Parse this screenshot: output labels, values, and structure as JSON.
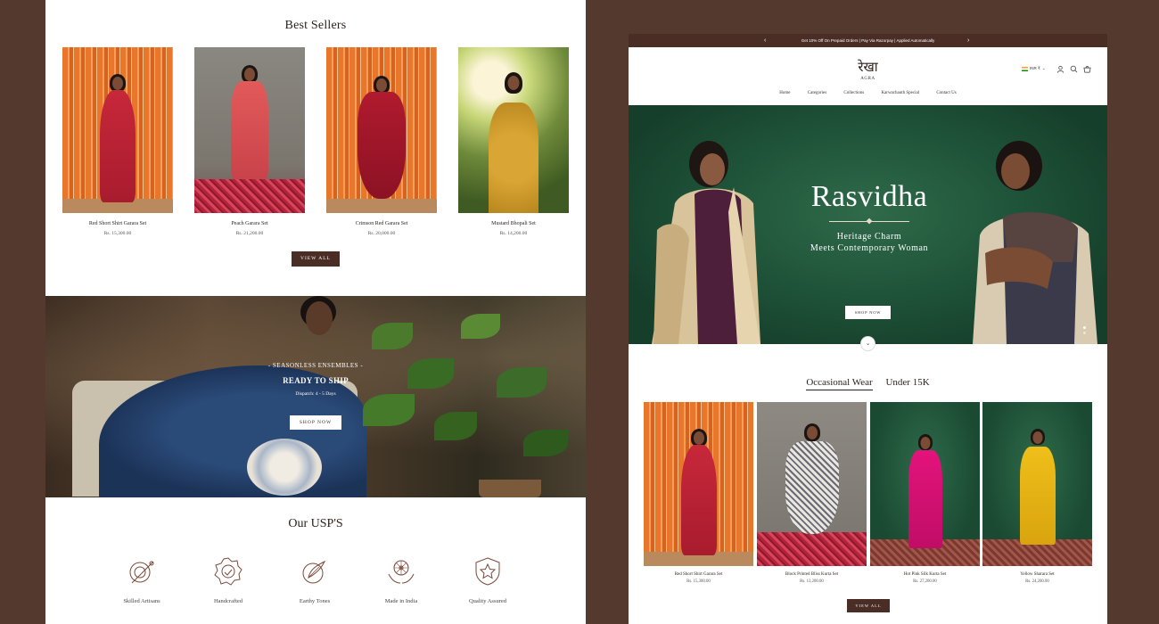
{
  "left": {
    "best_sellers": {
      "title": "Best Sellers",
      "products": [
        {
          "name": "Red Short Shirt Garara Set",
          "price": "Rs. 15,300.00"
        },
        {
          "name": "Peach Garara Set",
          "price": "Rs. 21,200.00"
        },
        {
          "name": "Crimson Red Garara Set",
          "price": "Rs. 20,000.00"
        },
        {
          "name": "Mustard Bhopali Set",
          "price": "Rs. 14,200.00"
        }
      ],
      "view_all": "VIEW ALL"
    },
    "promo": {
      "eyebrow": "- SEASONLESS ENSEMBLES -",
      "title": "READY TO SHIP",
      "subtitle": "Dispatch: 4 - 5 Days",
      "button": "SHOP NOW"
    },
    "usp": {
      "title": "Our USP'S",
      "items": [
        {
          "label": "Skilled Artisans",
          "icon": "needle-thread-icon"
        },
        {
          "label": "Handcrafted",
          "icon": "handcrafted-badge-icon"
        },
        {
          "label": "Earthy Tones",
          "icon": "leaf-brush-icon"
        },
        {
          "label": "Made in India",
          "icon": "chakra-hands-icon"
        },
        {
          "label": "Quality Assured",
          "icon": "star-shield-icon"
        }
      ]
    }
  },
  "right": {
    "announcement": "Get 10% Off On Prepaid Orders | Pay Via Razorpay | Applied Automatically",
    "logo": "रेखा",
    "logo_sub": "AGRA",
    "currency": "INR ₹",
    "nav": [
      "Home",
      "Categories",
      "Collections",
      "Karwachauth Special",
      "Contact Us"
    ],
    "hero": {
      "title": "Rasvidha",
      "subtitle_line1": "Heritage Charm",
      "subtitle_line2": "Meets Contemporary Woman",
      "button": "SHOP NOW"
    },
    "tabs": [
      "Occasional Wear",
      "Under 15K"
    ],
    "products": [
      {
        "name": "Red Short Shirt Garara Set",
        "price": "Rs. 15,300.00"
      },
      {
        "name": "Block Printed Bliss Kurta Set",
        "price": "Rs. 13,200.00"
      },
      {
        "name": "Hot Pink Silk Kurta Set",
        "price": "Rs. 27,200.00"
      },
      {
        "name": "Yellow Sharara Set",
        "price": "Rs. 24,200.00"
      }
    ],
    "view_all": "VIEW ALL"
  },
  "colors": {
    "page_background": "#54392f",
    "accent_brown": "#4a2e26",
    "hero_green": "#1f5339"
  }
}
